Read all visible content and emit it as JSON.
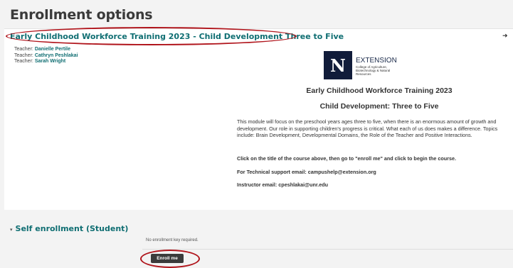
{
  "page": {
    "title": "Enrollment options"
  },
  "course": {
    "name": "Early Childhood Workforce Training 2023 - Child Development Three to Five",
    "enrol_icon": "enrol-arrow-icon",
    "teachers": [
      {
        "role": "Teacher:",
        "name": "Danielle Pertile"
      },
      {
        "role": "Teacher:",
        "name": "Cathryn Peshlakai"
      },
      {
        "role": "Teacher:",
        "name": "Sarah Wright"
      }
    ],
    "logo": {
      "letter": "N",
      "line1": "EXTENSION",
      "line2": "College of Agriculture, Biotechnology & Natural Resources"
    },
    "heading_1": "Early Childhood Workforce Training 2023",
    "heading_2": "Child Development: Three to Five",
    "description": "This module will focus on the preschool years ages three to five, when there is an enormous amount of growth and development. Our role in supporting children's progress is critical. What each of us does makes a difference. Topics include: Brain Development, Developmental Domains, the Role of the Teacher and Positive Interactions.",
    "instruction": "Click on the title of the course above, then go to \"enroll me\" and click to begin the course.",
    "tech_support": "For Technical support email: campushelp@extension.org",
    "instructor_email": "Instructor email: cpeshlakai@unr.edu"
  },
  "self_enrolment": {
    "caret": "▾",
    "title": "Self enrollment (Student)",
    "no_key": "No enrollment key required.",
    "button_label": "Enroll me"
  },
  "colors": {
    "accent": "#0f6e72",
    "highlight": "#b0141b",
    "button": "#3b3b3b"
  }
}
